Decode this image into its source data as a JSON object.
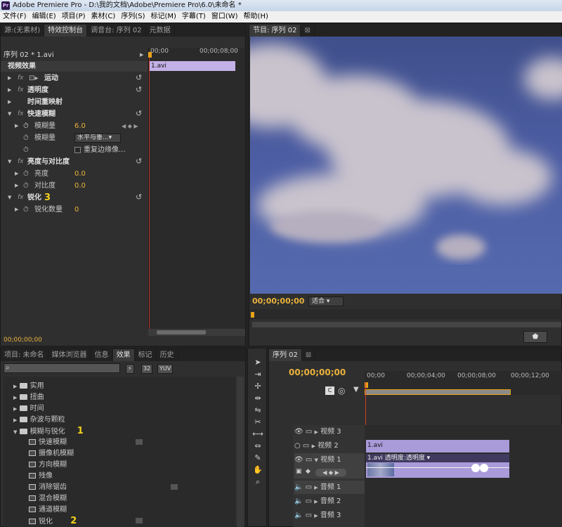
{
  "titlebar": {
    "app_icon": "Pr",
    "title": "Adobe Premiere Pro - D:\\我的文档\\Adobe\\Premiere Pro\\6.0\\未命名 *"
  },
  "menu": [
    "文件(F)",
    "编辑(E)",
    "项目(P)",
    "素材(C)",
    "序列(S)",
    "标记(M)",
    "字幕(T)",
    "窗口(W)",
    "帮助(H)"
  ],
  "top_left_tabs": [
    "源:(无素材)",
    "特效控制台",
    "调音台: 序列 02",
    "元数据"
  ],
  "effect_controls": {
    "clip_header": "序列 02 * 1.avi",
    "ruler_start": "00;00",
    "ruler_end": "00;00;08;00",
    "clip_bar": "1.avi",
    "section_title": "视频效果",
    "rows": [
      {
        "label": "运动",
        "fx": "fx",
        "bold": true
      },
      {
        "label": "透明度",
        "fx": "fx",
        "bold": true
      },
      {
        "label": "时间重映射",
        "fx": "",
        "bold": true
      },
      {
        "label": "快速模糊",
        "fx": "fx",
        "bold": true
      },
      {
        "label": "模糊量",
        "value": "6.0"
      },
      {
        "label": "模糊量",
        "dropdown": "水平与垂...▾"
      },
      {
        "label": "重复边缘像...",
        "checkbox": true
      },
      {
        "label": "亮度与对比度",
        "fx": "fx",
        "bold": true
      },
      {
        "label": "亮度",
        "value": "0.0"
      },
      {
        "label": "对比度",
        "value": "0.0"
      },
      {
        "label": "锐化",
        "fx": "fx",
        "bold": true
      },
      {
        "label": "锐化数量",
        "value": "0"
      }
    ],
    "annotation": "3",
    "timecode": "00;00;00;00"
  },
  "program_monitor": {
    "tab": "节目: 序列 02",
    "timecode": "00;00;00;00",
    "fit": "适合"
  },
  "project_panel": {
    "tabs": [
      "项目: 未命名",
      "媒体浏览器",
      "信息",
      "效果",
      "标记",
      "历史"
    ],
    "search_placeholder": "",
    "buttons": [
      "32",
      "YUV"
    ],
    "folders": [
      {
        "label": "实用",
        "expanded": false
      },
      {
        "label": "扭曲",
        "expanded": false
      },
      {
        "label": "时间",
        "expanded": false
      },
      {
        "label": "杂波与颗粒",
        "expanded": false
      },
      {
        "label": "模糊与锐化",
        "expanded": true
      }
    ],
    "effects": [
      "快速模糊",
      "摄像机模糊",
      "方向模糊",
      "残像",
      "消除锯齿",
      "混合模糊",
      "通道模糊",
      "锐化"
    ],
    "annotations": [
      "1",
      "2"
    ]
  },
  "timeline": {
    "tab": "序列 02",
    "timecode": "00;00;00;00",
    "ruler": [
      "00;00",
      "00;00;04;00",
      "00;00;08;00",
      "00;00;12;00"
    ],
    "tracks": [
      {
        "label": "视频 3",
        "type": "video"
      },
      {
        "label": "视频 2",
        "type": "video"
      },
      {
        "label": "视频 1",
        "type": "video"
      },
      {
        "label": "音频 1",
        "type": "audio"
      },
      {
        "label": "音频 2",
        "type": "audio"
      },
      {
        "label": "音频 3",
        "type": "audio"
      }
    ],
    "clip_v2": "1.avi",
    "clip_v1": "1.avi  透明度:透明度 ▾"
  }
}
